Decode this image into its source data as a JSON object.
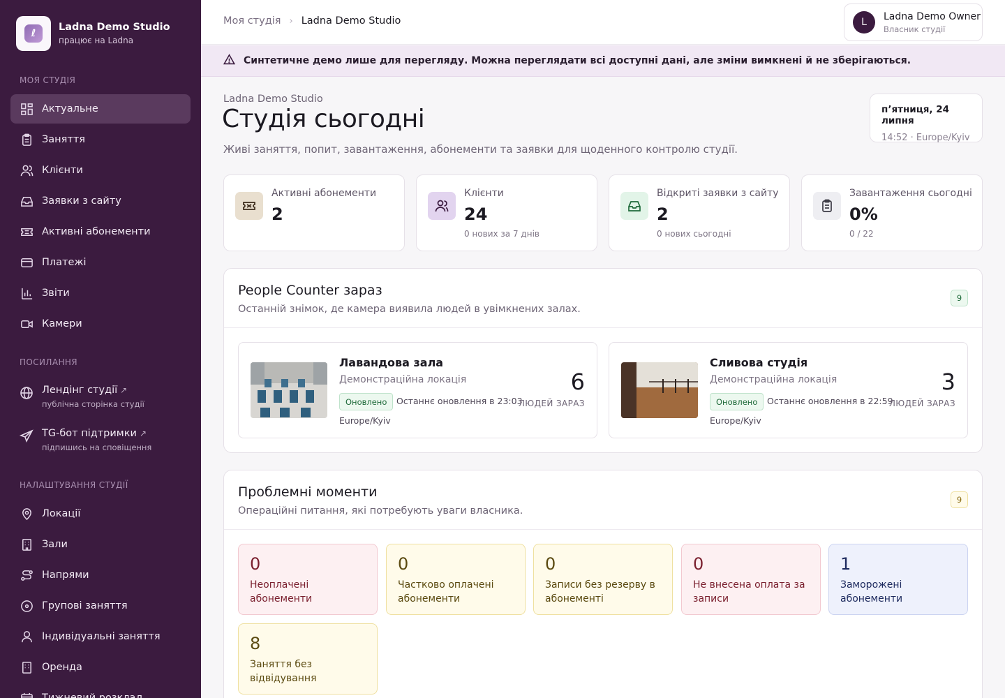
{
  "brand": {
    "name": "Ladna Demo Studio",
    "sub": "працює на Ladna"
  },
  "sidebar": {
    "section_studio": "Моя студія",
    "items": [
      {
        "label": "Актуальне",
        "icon": "dashboard-icon"
      },
      {
        "label": "Заняття",
        "icon": "clipboard-icon"
      },
      {
        "label": "Клієнти",
        "icon": "users-icon"
      },
      {
        "label": "Заявки з сайту",
        "icon": "inbox-icon"
      },
      {
        "label": "Активні абонементи",
        "icon": "ticket-icon"
      },
      {
        "label": "Платежі",
        "icon": "card-icon"
      },
      {
        "label": "Звіти",
        "icon": "chart-icon"
      },
      {
        "label": "Камери",
        "icon": "camera-icon"
      }
    ],
    "section_links": "Посилання",
    "links": [
      {
        "label": "Лендінг студії",
        "sub": "публічна сторінка студії",
        "icon": "globe-icon"
      },
      {
        "label": "TG-бот підтримки",
        "sub": "підпишись на сповіщення",
        "icon": "send-icon"
      }
    ],
    "section_settings": "Налаштування студії",
    "settings": [
      {
        "label": "Локації",
        "icon": "map-pin-icon"
      },
      {
        "label": "Зали",
        "icon": "building-icon"
      },
      {
        "label": "Напрями",
        "icon": "route-icon"
      },
      {
        "label": "Групові заняття",
        "icon": "circle-icon"
      },
      {
        "label": "Індивідуальні заняття",
        "icon": "user-icon"
      },
      {
        "label": "Оренда",
        "icon": "building-icon"
      },
      {
        "label": "Тижневий розклад",
        "icon": "calendar-icon"
      }
    ]
  },
  "topbar": {
    "crumb_1": "Моя студія",
    "crumb_2": "Ladna Demo Studio",
    "user_initial": "L",
    "user_name": "Ladna Demo Owner",
    "user_role": "Власник студії"
  },
  "banner": {
    "text": "Синтетичне демо лише для перегляду. Можна переглядати всі доступні дані, але зміни вимкнені й не зберігаються."
  },
  "header": {
    "studio": "Ladna Demo Studio",
    "title": "Студія сьогодні",
    "subtitle": "Живі заняття, попит, завантаження, абонементи та заявки для щоденного контролю студії.",
    "date": "п’ятниця, 24 липня",
    "time": "14:52 · Europe/Kyiv"
  },
  "stats": [
    {
      "label": "Активні абонементи",
      "value": "2",
      "note": "",
      "icon": "ticket-icon",
      "bg": "#e9dfcf",
      "stroke": "#3b2a1a"
    },
    {
      "label": "Клієнти",
      "value": "24",
      "note": "0 нових за 7 днів",
      "icon": "users-icon",
      "bg": "#e2d4ef",
      "stroke": "#3b1b3f"
    },
    {
      "label": "Відкриті заявки з сайту",
      "value": "2",
      "note": "0 нових сьогодні",
      "icon": "inbox-icon",
      "bg": "#e2f4e8",
      "stroke": "#1f6a3a"
    },
    {
      "label": "Завантаження сьогодні",
      "value": "0%",
      "note": "0 / 22",
      "icon": "clipboard-icon",
      "bg": "#eeeef2",
      "stroke": "#3b3a44"
    }
  ],
  "people_counter": {
    "title": "People Counter зараз",
    "subtitle": "Останній знімок, де камера виявила людей в увімкнених залах.",
    "count": "9",
    "rooms": [
      {
        "name": "Лавандова зала",
        "location": "Демонстраційна локація",
        "badge": "Оновлено",
        "updated": "Останнє оновлення в 23:03",
        "tz": "Europe/Kyiv",
        "people": "6",
        "people_label": "людей зараз"
      },
      {
        "name": "Сливова студія",
        "location": "Демонстраційна локація",
        "badge": "Оновлено",
        "updated": "Останнє оновлення в 22:59",
        "tz": "Europe/Kyiv",
        "people": "3",
        "people_label": "людей зараз"
      }
    ]
  },
  "issues": {
    "title": "Проблемні моменти",
    "subtitle": "Операційні питання, які потребують уваги власника.",
    "count": "9",
    "items": [
      {
        "value": "0",
        "label": "Неоплачені абонементи",
        "tone": "red"
      },
      {
        "value": "0",
        "label": "Частково оплачені абонементи",
        "tone": "yellow"
      },
      {
        "value": "0",
        "label": "Записи без резерву в абонементі",
        "tone": "yellow"
      },
      {
        "value": "0",
        "label": "Не внесена оплата за записи",
        "tone": "red"
      },
      {
        "value": "1",
        "label": "Заморожені абонементи",
        "tone": "blue"
      },
      {
        "value": "8",
        "label": "Заняття без відвідування",
        "tone": "yellow"
      }
    ]
  }
}
